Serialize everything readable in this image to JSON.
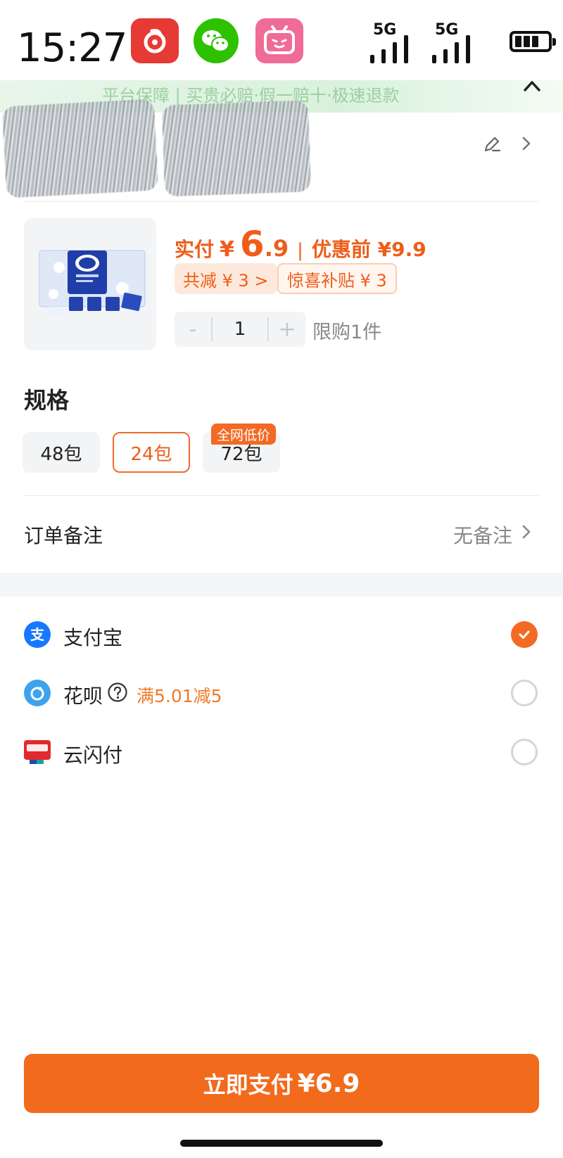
{
  "status_bar": {
    "time": "15:27",
    "apps": [
      "netease-music-icon",
      "wechat-icon",
      "bilibili-icon"
    ],
    "network": [
      "5G",
      "5G"
    ]
  },
  "guarantee": {
    "text": "平台保障 | 买贵必赔·假一赔十·极速退款"
  },
  "product": {
    "price_label": "实付",
    "currency": "¥",
    "price_int": "6",
    "price_dec": ".9",
    "separator": "|",
    "original_price": "优惠前 ¥9.9",
    "discount_tag": "共减 ¥ 3 >",
    "subsidy_tag": "惊喜补贴 ¥ 3",
    "quantity": "1",
    "minus": "-",
    "plus": "+",
    "limit_text": "限购1件"
  },
  "spec": {
    "title": "规格",
    "options": [
      {
        "label": "48包",
        "selected": false
      },
      {
        "label": "24包",
        "selected": true
      },
      {
        "label": "72包",
        "selected": false
      }
    ],
    "badge": "全网低价"
  },
  "note": {
    "label": "订单备注",
    "value": "无备注"
  },
  "payment": {
    "methods": [
      {
        "name": "支付宝",
        "icon": "alipay-icon",
        "selected": true
      },
      {
        "name": "花呗",
        "icon": "huabei-icon",
        "promo": "满5.01减5",
        "selected": false
      },
      {
        "name": "云闪付",
        "icon": "unionpay-icon",
        "selected": false
      }
    ]
  },
  "pay_button": {
    "label": "立即支付",
    "amount": "¥6.9"
  },
  "colors": {
    "accent": "#f26a1c",
    "price": "#ef5d1a",
    "alipay": "#1677ff"
  }
}
